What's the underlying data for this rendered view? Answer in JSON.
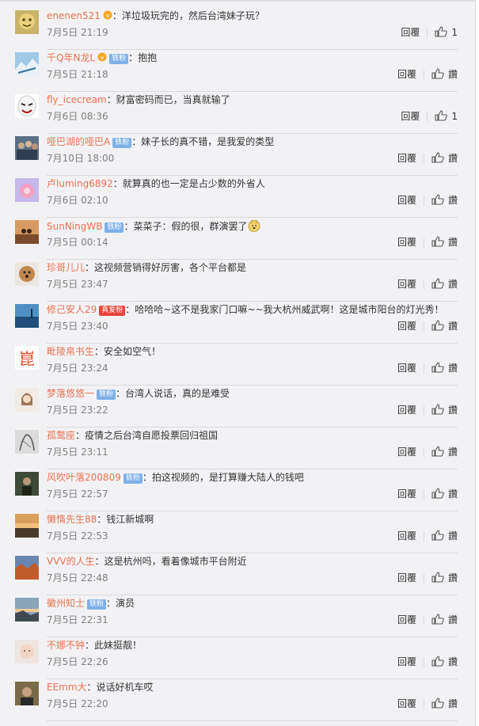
{
  "labels": {
    "reply": "回覆",
    "like": "讚"
  },
  "colors": {
    "username": "#eb7350",
    "background": "#f2f2f5",
    "fan_badge": "#7fb1e8",
    "hot_badge": "#e8453c"
  },
  "comments": [
    {
      "user": "enenen521",
      "vip": true,
      "text": "：洋垃圾玩完的，然后台湾妹子玩？",
      "time": "7月5日 21:19",
      "likes": "1",
      "avatar": "yellow-face-icon"
    },
    {
      "user": "千Q年N龙L",
      "vip": true,
      "badge": "铁粉",
      "text": "：抱抱",
      "time": "7月5日 21:18",
      "likes": "讚",
      "avatar": "blue-sky-icon"
    },
    {
      "user": "fly_icecream",
      "text": "：财富密码而已，当真就输了",
      "time": "7月6日 08:36",
      "likes": "1",
      "avatar": "mask-face-icon"
    },
    {
      "user": "哑巴湖的哑巴A",
      "badge": "铁粉",
      "text": "：妹子长的真不错，是我爱的类型",
      "time": "7月10日 18:00",
      "likes": "讚",
      "avatar": "crowd-photo-icon"
    },
    {
      "user": "卢luming6892",
      "text": "：就算真的也一定是占少数的外省人",
      "time": "7月6日 02:10",
      "likes": "讚",
      "avatar": "pink-flower-icon"
    },
    {
      "user": "SunNingWB",
      "badge": "铁粉",
      "text": "：菜菜子：假的很，群演罢了",
      "emoji": "doge-emoji-icon",
      "time": "7月5日 00:14",
      "likes": "讚",
      "avatar": "sunset-photo-icon"
    },
    {
      "user": "珍哥儿儿",
      "text": "：这视频营销得好厉害，各个平台都是",
      "time": "7月5日 23:47",
      "likes": "讚",
      "avatar": "dog-photo-icon"
    },
    {
      "user": "修己安人29",
      "badge": "真爱粉",
      "badge_type": "hot",
      "text": "：哈哈哈~这不是我家门口嘛~~我大杭州威武啊！这是城市阳台的灯光秀！",
      "time": "7月5日 23:40",
      "likes": "讚",
      "avatar": "lake-photo-icon"
    },
    {
      "user": "毗陵帛书生",
      "text": "：安全如空气！",
      "time": "7月5日 23:24",
      "likes": "讚",
      "avatar": "red-glyph-icon"
    },
    {
      "user": "梦落悠悠一",
      "badge": "铁粉",
      "text": "：台湾人说话，真的是难受",
      "time": "7月5日 23:22",
      "likes": "讚",
      "avatar": "girl-drawing-icon"
    },
    {
      "user": "孤鹜座",
      "text": "：疫情之后台湾自愿投票回归祖国",
      "time": "7月5日 23:11",
      "likes": "讚",
      "avatar": "sketch-portrait-icon"
    },
    {
      "user": "风吹叶落200809",
      "badge": "铁粉",
      "text": "：拍这视频的，是打算赚大陆人的钱吧",
      "time": "7月5日 22:57",
      "likes": "讚",
      "avatar": "dark-photo-icon"
    },
    {
      "user": "懒惰先生88",
      "text": "：钱江新城啊",
      "time": "7月5日 22:53",
      "likes": "讚",
      "avatar": "dusk-landscape-icon"
    },
    {
      "user": "VVV的人生",
      "text": "：这是杭州吗，看着像城市平台附近",
      "time": "7月5日 22:48",
      "likes": "讚",
      "avatar": "red-canyon-icon"
    },
    {
      "user": "徽州知士",
      "badge": "铁粉",
      "text": "：演员",
      "time": "7月5日 22:31",
      "likes": "讚",
      "avatar": "mountain-sunrise-icon"
    },
    {
      "user": "不娜不钟",
      "text": "：此妹挺靓！",
      "time": "7月5日 22:26",
      "likes": "讚",
      "avatar": "baby-photo-icon"
    },
    {
      "user": "EEmm大",
      "text": "：说话好机车哎",
      "time": "7月5日 22:20",
      "likes": "讚",
      "avatar": "man-portrait-icon"
    }
  ]
}
